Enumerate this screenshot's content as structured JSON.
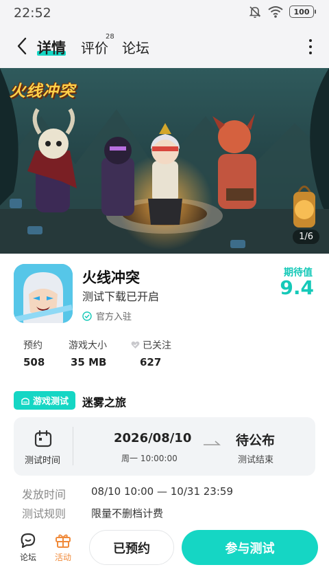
{
  "status_bar": {
    "time": "22:52",
    "battery": "100"
  },
  "nav": {
    "tabs": [
      {
        "label": "详情"
      },
      {
        "label": "评价",
        "badge": "28"
      },
      {
        "label": "论坛"
      }
    ]
  },
  "banner": {
    "logo_text": "火线冲突",
    "page_indicator": "1/6"
  },
  "game": {
    "name": "火线冲突",
    "status": "测试下载已开启",
    "official_label": "官方入驻",
    "expect_label": "期待值",
    "expect_score": "9.4"
  },
  "stats": [
    {
      "label": "预约",
      "value": "508"
    },
    {
      "label": "游戏大小",
      "value": "35 MB"
    },
    {
      "label": "已关注",
      "value": "627"
    }
  ],
  "test": {
    "badge": "游戏测试",
    "name": "迷雾之旅",
    "time_label": "测试时间",
    "date": "2026/08/10",
    "day_time": "周一  10:00:00",
    "pending": "待公布",
    "end_label": "测试结束"
  },
  "info": [
    {
      "key": "发放时间",
      "value": "08/10 10:00 — 10/31 23:59"
    },
    {
      "key": "测试规则",
      "value": "限量不删档计费"
    }
  ],
  "bottom": {
    "forum_label": "论坛",
    "activity_label": "活动",
    "reserved_label": "已预约",
    "join_label": "参与测试"
  },
  "colors": {
    "accent": "#15d6c4",
    "activity": "#f08a3a"
  }
}
